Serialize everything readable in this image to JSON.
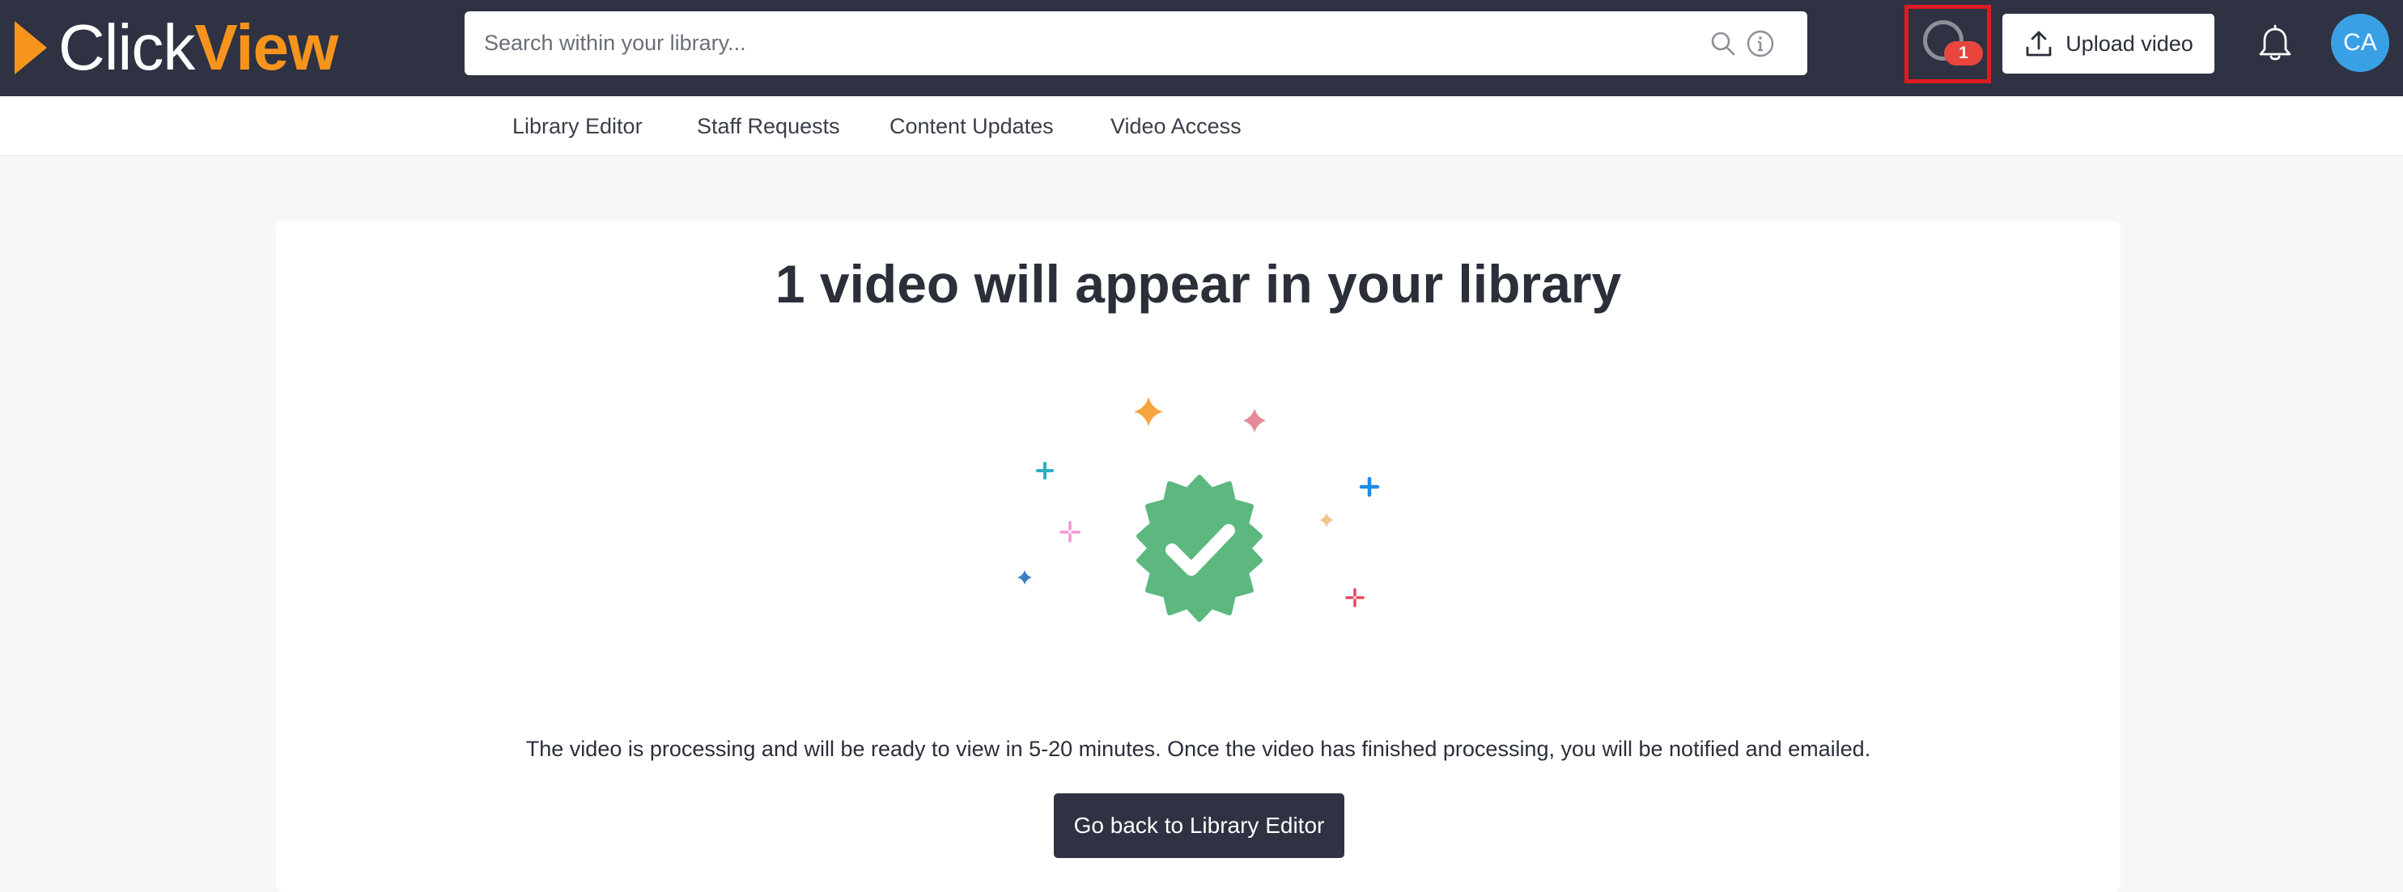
{
  "brand": {
    "name_part1": "Click",
    "name_part2": "View",
    "accent_color": "#f7941d",
    "header_color": "#2e3242"
  },
  "header": {
    "search": {
      "placeholder": "Search within your library..."
    },
    "processing_indicator": {
      "badge_count": "1",
      "highlight_color": "#e01a22"
    },
    "upload_button": {
      "label": "Upload video",
      "icon": "upload-icon"
    },
    "notifications": {
      "icon": "bell-icon"
    },
    "user": {
      "initials": "CA",
      "avatar_color": "#3aa0e6"
    }
  },
  "subnav": {
    "items": [
      {
        "label": "Library Editor"
      },
      {
        "label": "Staff Requests"
      },
      {
        "label": "Content Updates"
      },
      {
        "label": "Video Access"
      }
    ]
  },
  "main": {
    "title": "1 video will appear in your library",
    "illustration": {
      "icon": "verified-badge-icon",
      "badge_color": "#5cb87f"
    },
    "message": "The video is processing and will be ready to view in 5-20 minutes. Once the video has finished processing, you will be notified and emailed.",
    "back_button_label": "Go back to Library Editor"
  }
}
